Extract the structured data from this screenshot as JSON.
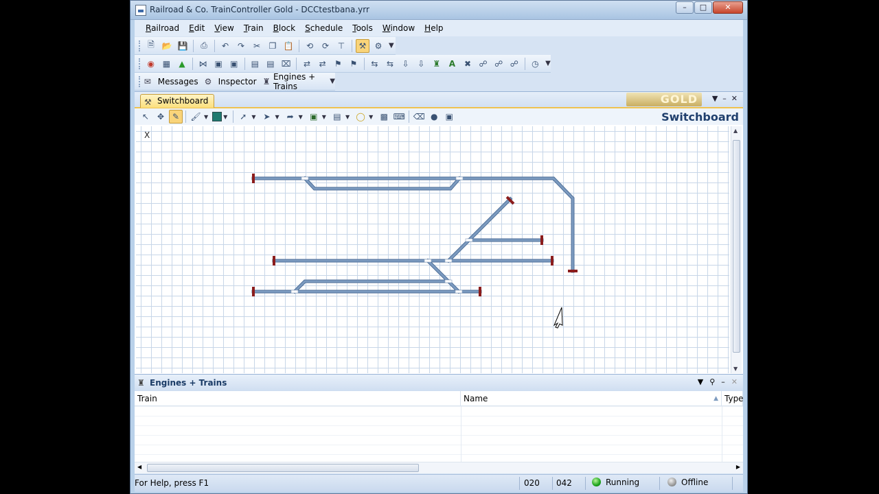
{
  "window": {
    "title": "Railroad & Co. TrainController Gold  -  DCCtestbana.yrr"
  },
  "menu": [
    "Railroad",
    "Edit",
    "View",
    "Train",
    "Block",
    "Schedule",
    "Tools",
    "Window",
    "Help"
  ],
  "toolbar3": {
    "messages": "Messages",
    "inspector": "Inspector",
    "engines": "Engines + Trains"
  },
  "switchboard": {
    "tab_label": "Switchboard",
    "heading": "Switchboard",
    "logo_text": "GOLD",
    "x_label": "X"
  },
  "panel": {
    "title": "Engines + Trains",
    "columns": [
      "Train",
      "Name",
      "Type"
    ]
  },
  "status": {
    "help": "For Help, press F1",
    "field1": "020",
    "field2": "042",
    "running": "Running",
    "offline": "Offline"
  },
  "colors": {
    "track": "#7c9bc0",
    "track_outline": "#4f6f98",
    "bumper": "#8b1d1d",
    "grid": "#c7d6e8"
  }
}
